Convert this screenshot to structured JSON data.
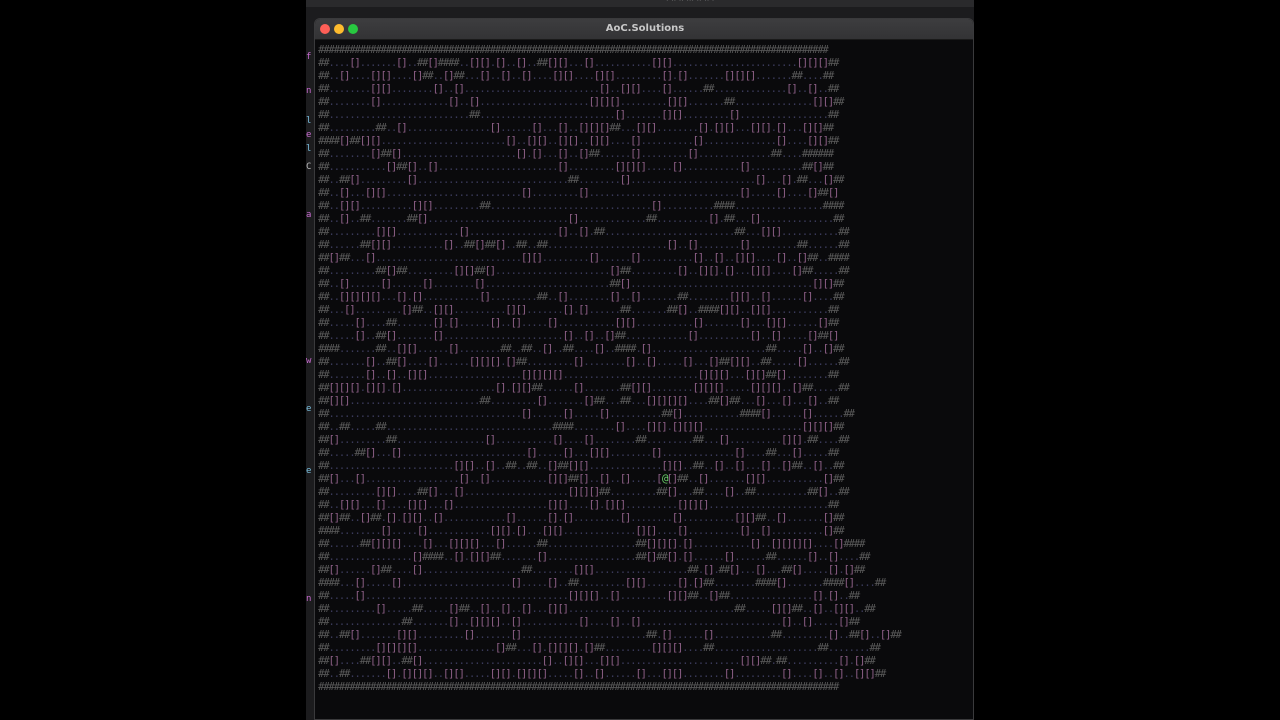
{
  "window": {
    "title": "AoC.Solutions"
  },
  "background_window": {
    "topbar_text": "· ·· ·· ··· ·· ·· ·",
    "side_marks": [
      "f",
      "n",
      "l",
      "e",
      "l",
      "C",
      "a",
      "w",
      "e",
      "e",
      "n"
    ]
  },
  "warehouse_map": {
    "rows": [
      "##################################################################################################",
      "##....[].......[]..##[]####..[][].[]..[]..##[][]...[]...........[][]........................[][][]##",
      "##..[]....[][]....[]##..[]##...[]..[]..[]....[][]....[][].........[].[].......[][][].......##....##",
      "##........[][]........[]..[]..........................[]..[][]....[]......##..............[]..[]..##",
      "##........[].............[]..[].....................[][][].........[][].......##...............[][]##",
      "##...........................##..........................[].......[][].........[].................##",
      "##.........##..[]................[]......[]...[]..[][][]##...[][]........[].[][]...[][].[]...[][]##",
      "####[]##[][]........................[]..[][]..[][]..[][]....[]..........[]..............[]....[][]##",
      "##........[]##[]......................[].[]...[]..[]##......[].........[]..............##....######",
      "##...........[]##[]..[].......................[].........[][][].....[]...........[]..........##[]##",
      "##..##[].........[].............................##........[]........................[]...[].##...[]##",
      "##..[]...[][]..........................[].........[].............................[].....[]....[]##[]",
      "##..[][]..........[][].........##...............................[]..........####.................####",
      "##..[]..##.......##[]...........................[].............##..........[].##...[]..............##",
      "##.........[][]............[].................[]..[].##.........................##...[][]...........##",
      "##......##[][]..........[]..##[]##[]..##..##.......................[]..[]........[].........##......##",
      "##[]##...[]............................[][].........[]......[]..........[]..[]..[][]....[]..[]##..####",
      "##.........##[]##.........[][]##[]......................[]##.........[]..[][].[]...[][]....[]##.....##",
      "##..[]......[]......[]........[]........................##[]...................................[][]##",
      "##..[][][][]...[].[]...........[].........##..[]........[]..[].......##........[][]..[]......[]....##",
      "##...[].........[]##..[][]..........[][].......[].[]......##.......##[]..####[][]..[][]...........##",
      "##.....[]....##.......[].[]......[]..[].....[]...........[][]...........[].......[]...[][]......[]##",
      "##.....[]..##[].......[].......................[]..[]..[]##............[]..........[]..[].....[]##[]",
      "####.......##..[][]......[]........##..##..[]..##....[]..####.[]......................##.....[]..[]##",
      "##.......[]..##[]....[]......[][][].[]##.........[]........[]..[].....[]...[]##[][]..##.....[]......##",
      "##.......[]..[]..[][]..................[][][][]..........................[][][]...[][]##[]........##",
      "##[][][].[][].[]..................[].[][]##......[].......##[][]........[][][].....[][][]..[]##.....##",
      "##[][].........................##.........[].......[]##...##...[][][][]....##[]##...[]...[]...[]..##",
      "##.....................................[]......[].....[]..........##[]...........####[]......[]......##",
      "##..##.....##................................####........[]....[][].[][][]...................[][][]##",
      "##[].........##.................[]...........[]....[]........##.........##...[]..........[][].##....##",
      "##.....##[]...[]........................[].....[]...[][]........[]..............[]....##...[].....##",
      "##........................[][]..[]..##..##..[]##[][]..............[][]..##..[]..[]...[]..[]##..[]..##",
      "##[]...[]..................[]..[]...........[][]##[]..[]..[].....[][]##..[].......[][]...........[]##",
      "##.........[][]....##[]...[]....................[][][]##.........##[]...##....[]..##..........##[]..##",
      "##..[][]...[]....[][]...[]..................[][]....[].[][]..........[][][].......................##",
      "##[]##..[]##.[].[][]..[]............[]......[].[].........[]........[]..........[][]##..[].......[]##",
      "####........[].....[]............[][].[]...[][]..............[][]....[]..........[]..[]..........[]##",
      "##......##[][][]....[]...[][][]...[]......##.................##[][][].[]...........[]..[][][][]....[]####",
      "##................[]####..[].[][]##.......[].................##[]##[].[]......[]......##......[]..[]....##",
      "##[]......[]##....[]...................##........[][]..................##.[].##[]...[]...##[].....[].[]##",
      "####...[].....[].....................[].....[]..##.........[][]......[].[]##........####[].......####[]....##",
      "##.....[].......................................[][][]..[].........[][]##..[]##................[].[]..##",
      "##.........[].....##.....[]##..[]..[]..[]...[][]................................##.....[][]##..[]..[][]..##",
      "##..............##.......[]..[][][]..[]...........[]....[]..[]...........................[]..[].....[]##",
      "##..##[].......[][].........[].......[]........................##.[]......[]...........##.........[]..##[]..[]##",
      "##.........[][][][]...............[]##...[].[][][].[]##.........[][][]....##....................##........##",
      "##[]....##[][]..##[].......................[]..[][]...[][].......................[][]##.##..........[].[]##",
      "##..##.......[].[][][]..[][].....[][].[][][].....[]..[]......[]...[][]........[].........[]....[]..[]..[][]##",
      "####################################################################################################"
    ],
    "robot_row": 33,
    "robot_symbol": "@",
    "colors": {
      "wall": "#5a5a5a",
      "box": "#8c5f86",
      "floor": "#3a3a5a",
      "robot": "#6bd26b"
    }
  }
}
